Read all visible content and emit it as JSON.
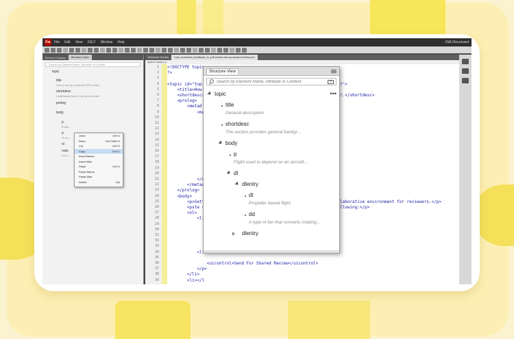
{
  "app": {
    "logo": "Fm",
    "menus": [
      "File",
      "Edit",
      "View",
      "XSLT",
      "Window",
      "Help"
    ],
    "workspace": "XML/Structured"
  },
  "left_panel": {
    "tabs": [
      "Element Catalog",
      "Structure View"
    ],
    "search_placeholder": "Search by Element Name, Attribute or Content",
    "nodes": [
      {
        "label": "topic",
        "sub": ""
      },
      {
        "label": "title",
        "sub": "How to set up a shared PDF review"
      },
      {
        "label": "shortdesc",
        "sub": "Understand how to set up a shared..."
      },
      {
        "label": "prolog",
        "sub": ""
      },
      {
        "label": "body",
        "sub": ""
      },
      {
        "label": "p",
        "sub": "Email..."
      },
      {
        "label": "p",
        "sub": "To so..."
      },
      {
        "label": "ol",
        "sub": ""
      },
      {
        "label": "note",
        "sub": "For s..."
      }
    ]
  },
  "context_menu": [
    {
      "label": "Undo",
      "shortcut": "Ctrl+Z"
    },
    {
      "label": "Redo",
      "shortcut": "Ctrl+Shift+Z"
    },
    {
      "label": "Cut",
      "shortcut": "Ctrl+X"
    },
    {
      "label": "Copy",
      "shortcut": "Ctrl+C"
    },
    {
      "label": "Insert Before",
      "shortcut": ""
    },
    {
      "label": "Insert After",
      "shortcut": ""
    },
    {
      "label": "Paste",
      "shortcut": "Ctrl+V"
    },
    {
      "label": "Paste Before",
      "shortcut": ""
    },
    {
      "label": "Paste After",
      "shortcut": ""
    },
    {
      "label": "Delete",
      "shortcut": "Del"
    }
  ],
  "editor": {
    "tabs": [
      "Welcome Screen",
      "how_reviewers_feedback_in_pdf-review-set-up-shared-review.xml"
    ],
    "breadcrumb": "topic  ▸  body  ▸  p",
    "line_numbers": [
      "1",
      "2",
      "3",
      "4",
      "5",
      "6",
      "7",
      "8",
      "9",
      "10",
      "11",
      "12",
      "13",
      "14",
      "15",
      "16",
      "17",
      "18",
      "19",
      "20",
      "21",
      "22",
      "23",
      "24",
      "25",
      "26",
      "27",
      "28",
      "29",
      "30",
      "31",
      "32",
      "33",
      "34",
      "35",
      "36",
      "37",
      "38",
      "39"
    ],
    "code_lines": [
      "<!DOCTYPE topic",
      "?>",
      "",
      "<topic id=\"topi",
      "    <title>How",
      "    <shortdesc>",
      "    <prolog>",
      "        <metad",
      "            <me",
      "",
      "",
      "",
      "",
      "",
      "",
      "",
      "",
      "",
      "",
      "",
      "            </m",
      "        </metad",
      "    </prolog>",
      "    <body>",
      "        <p>Sett",
      "        <pste s",
      "        <ol>",
      "            <li",
      "",
      "",
      "",
      "",
      "",
      "",
      "",
      "",
      "",
      "",
      "            </l"
    ],
    "code_right": [
      {
        "line": 4,
        "text": "r\">"
      },
      {
        "line": 6,
        "text": "r.</shortdesc>"
      },
      {
        "line": 25,
        "text": "laborative environment for reviewers.</p>"
      },
      {
        "line": 26,
        "text": "llowing:</p>"
      }
    ],
    "code_bottom": [
      "            <li",
      "",
      "                <uicontrol>Send For Shared Review</uicontrol>",
      "            </p>",
      "        </li>",
      "        <li>"
    ]
  },
  "structure_view": {
    "title": "Structure View",
    "search_placeholder": "Search by Element Name, Attribute or Content",
    "more_label": "•••",
    "footer": "",
    "nodes": [
      {
        "label": "topic",
        "sub": "",
        "expander": "open"
      },
      {
        "label": "title",
        "sub": "General description",
        "expander": "leaf"
      },
      {
        "label": "shortdesc",
        "sub": "The section provides general backgr...",
        "expander": "leaf"
      },
      {
        "label": "body",
        "sub": "",
        "expander": "open"
      },
      {
        "label": "p",
        "sub": "Flight used to depend on an aircraft...",
        "expander": "leaf"
      },
      {
        "label": "dl",
        "sub": "",
        "expander": "open"
      },
      {
        "label": "dlentry",
        "sub": "",
        "expander": "open"
      },
      {
        "label": "dt",
        "sub": "Propeller based flight",
        "expander": "leaf"
      },
      {
        "label": "dd",
        "sub": "A type of fan that converts rotating...",
        "expander": "leaf"
      },
      {
        "label": "dlentry",
        "sub": "",
        "expander": "closed"
      }
    ]
  },
  "colors": {
    "background": "#fbf3cf",
    "accent_yellow": "#f6e658",
    "app_logo": "#b30b00",
    "selection": "#c7dcf4"
  }
}
